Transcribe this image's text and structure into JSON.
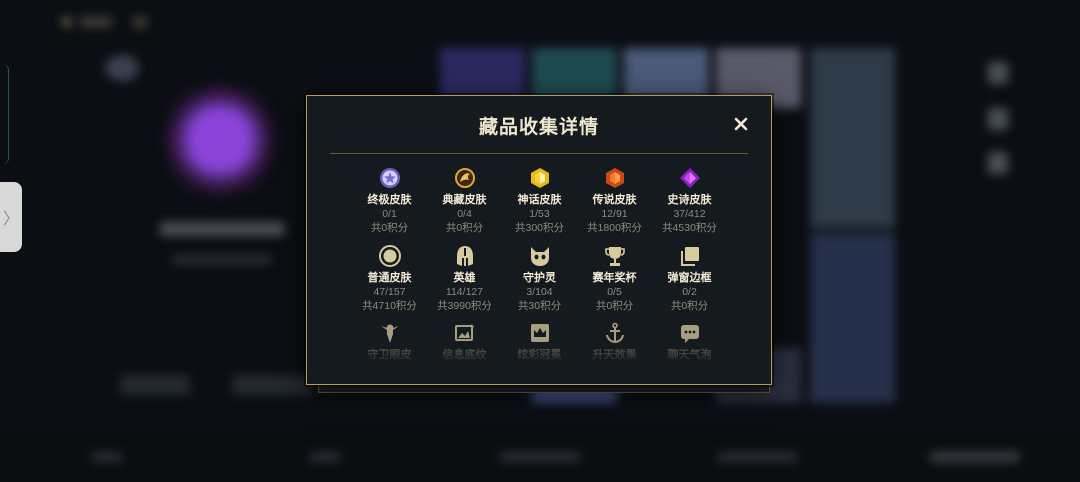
{
  "modal": {
    "title": "藏品收集详情",
    "close_glyph": "✕"
  },
  "categories": [
    {
      "name": "终极皮肤",
      "count": "0/1",
      "points": "共0积分",
      "icon": "ultimate-skin-icon",
      "color": "#b7a6f0"
    },
    {
      "name": "典藏皮肤",
      "count": "0/4",
      "points": "共0积分",
      "icon": "prestige-skin-icon",
      "color": "#e0a23a"
    },
    {
      "name": "神话皮肤",
      "count": "1/53",
      "points": "共300积分",
      "icon": "mythic-skin-icon",
      "color": "#e8b820"
    },
    {
      "name": "传说皮肤",
      "count": "12/91",
      "points": "共1800积分",
      "icon": "legendary-skin-icon",
      "color": "#e8742a"
    },
    {
      "name": "史诗皮肤",
      "count": "37/412",
      "points": "共4530积分",
      "icon": "epic-skin-icon",
      "color": "#b040e0"
    },
    {
      "name": "普通皮肤",
      "count": "47/157",
      "points": "共4710积分",
      "icon": "standard-skin-icon",
      "color": "#d8c9a0"
    },
    {
      "name": "英雄",
      "count": "114/127",
      "points": "共3990积分",
      "icon": "champion-helmet-icon",
      "color": "#d8c9a0"
    },
    {
      "name": "守护灵",
      "count": "3/104",
      "points": "共30积分",
      "icon": "guardian-icon",
      "color": "#d8c9a0"
    },
    {
      "name": "赛年奖杯",
      "count": "0/5",
      "points": "共0积分",
      "icon": "trophy-icon",
      "color": "#d8c9a0"
    },
    {
      "name": "弹窗边框",
      "count": "0/2",
      "points": "共0积分",
      "icon": "frame-icon",
      "color": "#d8c9a0"
    }
  ],
  "categories_partial": [
    {
      "name": "守卫眼皮",
      "icon": "ward-skin-icon"
    },
    {
      "name": "信息底纹",
      "icon": "banner-icon"
    },
    {
      "name": "炫彩冠冕",
      "icon": "crown-icon"
    },
    {
      "name": "升天效果",
      "icon": "ascend-effect-icon"
    },
    {
      "name": "聊天气泡",
      "icon": "chat-bubble-icon"
    }
  ],
  "side_tab": {
    "glyph": "〉"
  }
}
